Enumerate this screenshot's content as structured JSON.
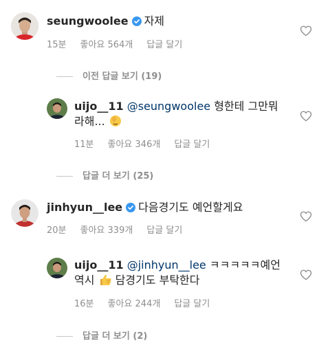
{
  "colors": {
    "text": "#262626",
    "meta": "#8e8e8e",
    "mention": "#003569",
    "verified": "#3897f0"
  },
  "comments": [
    {
      "username": "seungwoolee",
      "verified": true,
      "text": "자제",
      "time": "15분",
      "likes": "좋아요 564개",
      "reply": "답글 달기"
    },
    {
      "username": "jinhyun__lee",
      "verified": true,
      "text": "다음경기도 예언할게요",
      "time": "20분",
      "likes": "좋아요 339개",
      "reply": "답글 달기"
    }
  ],
  "replies": [
    {
      "username": "uijo__11",
      "mention": "@seungwoolee",
      "text_line1": "형한테 그만뭐",
      "text_line2": "라해...",
      "emoji": "facepalm-emoji",
      "time": "11분",
      "likes": "좋아요 346개",
      "reply": "답글 달기"
    },
    {
      "username": "uijo__11",
      "mention": "@jinhyun__lee",
      "text_line1": "ㅋㅋㅋㅋㅋ예언",
      "text_line2_prefix": "역시",
      "emoji": "thumbs-up-emoji",
      "text_line2_suffix": "담경기도 부탁한다",
      "time": "16분",
      "likes": "좋아요 244개",
      "reply": "답글 달기"
    }
  ],
  "view_more": {
    "previous_replies": "이전 답글 보기 (19)",
    "more_replies_1": "답글 더 보기 (25)",
    "more_replies_2": "답글 더 보기 (2)"
  }
}
